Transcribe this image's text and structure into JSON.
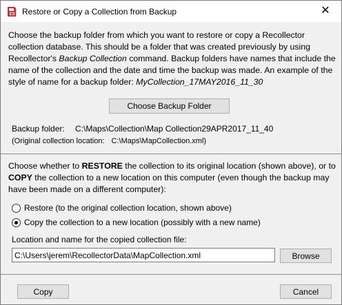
{
  "window": {
    "title": "Restore or Copy a Collection from Backup",
    "close_glyph": "✕",
    "app_icon": "recollector-app-icon"
  },
  "backup": {
    "desc_1": "Choose the backup folder from which you want to restore or copy a Recollector collection database. This should be a folder that was created previously by using Recollector's ",
    "desc_command": "Backup Collection",
    "desc_2": " command. Backup folders have names that include the name of the collection and the date and time the backup was made. An example of the style of name for a backup folder: ",
    "desc_example": "MyCollection_17MAY2016_11_30",
    "choose_button": "Choose Backup Folder",
    "folder_label": "Backup folder:",
    "folder_value": "C:\\Maps\\Collection\\Map Collection29APR2017_11_40",
    "original_label": "(Original collection location:",
    "original_value": "C:\\Maps\\MapCollection.xml)"
  },
  "mode": {
    "desc_1": "Choose whether to ",
    "restore_word": "RESTORE",
    "desc_2": " the collection to its original location (shown above), or to ",
    "copy_word": "COPY",
    "desc_3": " the collection to a new location on this computer (even though the backup may have been made on a different computer):",
    "options": [
      {
        "label": "Restore (to the original collection location, shown above)",
        "selected": false
      },
      {
        "label": "Copy the collection to a new location (possibly with a new name)",
        "selected": true
      }
    ],
    "location_label": "Location and name for the copied collection file:",
    "location_value": "C:\\Users\\jerem\\RecollectorData\\MapCollection.xml",
    "browse_button": "Browse"
  },
  "footer": {
    "copy_button": "Copy",
    "cancel_button": "Cancel"
  },
  "colors": {
    "icon_red": "#d42a2a",
    "divider": "#8c8c8c",
    "button_face": "#e1e1e1",
    "panel": "#f0f0f0"
  }
}
